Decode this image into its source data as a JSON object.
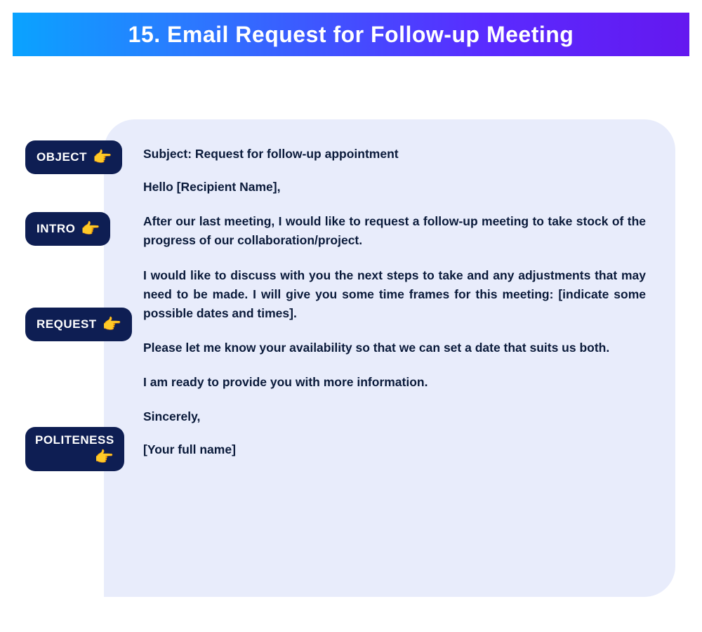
{
  "header": {
    "title": "15. Email Request for Follow-up Meeting"
  },
  "labels": {
    "object": "OBJECT",
    "intro": "INTRO",
    "request": "REQUEST",
    "politeness": "POLITENESS",
    "hand": "👉"
  },
  "email": {
    "subject": "Subject: Request for follow-up appointment",
    "greeting": "Hello [Recipient Name],",
    "intro": "After our last meeting, I would like to request a follow-up meeting to take stock of the progress of our collaboration/project.",
    "request1": "I would like to discuss with you the next steps to take and any adjustments that may need to be made. I will give you some time frames for this meeting: [indicate some possible dates and times].",
    "request2": "Please let me know your availability so that we can set a date that suits us both.",
    "request3": "I am ready to provide you with more information.",
    "signoff": "Sincerely,",
    "signature": "[Your full name]"
  }
}
